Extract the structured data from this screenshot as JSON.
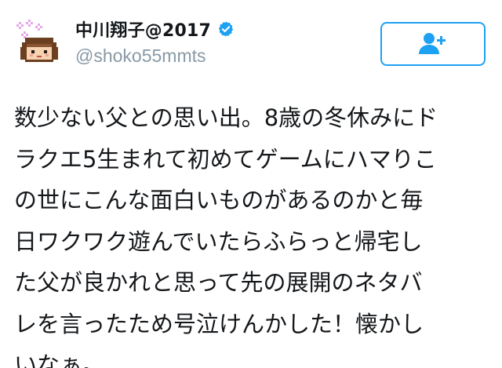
{
  "tweet": {
    "display_name": "中川翔子@2017",
    "handle": "@shoko55mmts",
    "verified": true,
    "avatar_icon": "pixel-art-avatar",
    "follow_icon": "add-user-icon",
    "accent_color": "#1da1f2",
    "text": "数少ない父との思い出。8歳の冬休みにド\nラクエ5生まれて初めてゲームにハマりこ\nの世にこんな面白いものがあるのかと毎\n日ワクワク遊んでいたらふらっと帰宅し\nた父が良かれと思って先の展開のネタバ\nレを言ったため号泣けんかした！懐かし\nいなぁ。"
  }
}
